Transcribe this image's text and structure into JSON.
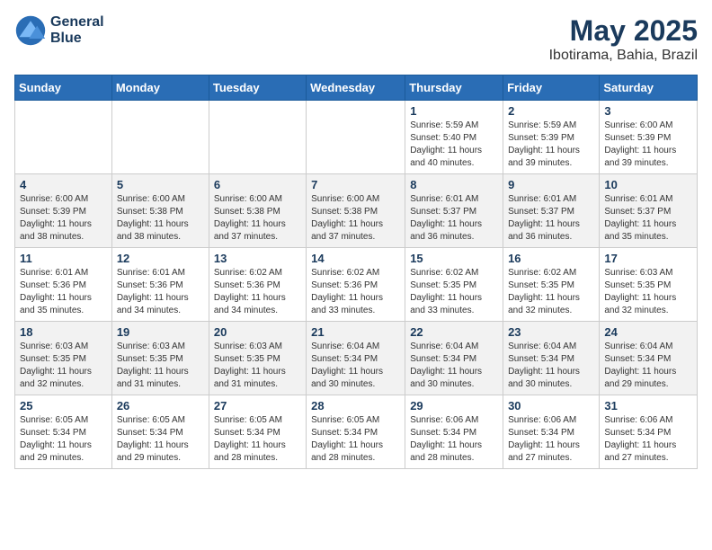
{
  "header": {
    "logo_line1": "General",
    "logo_line2": "Blue",
    "title": "May 2025",
    "subtitle": "Ibotirama, Bahia, Brazil"
  },
  "days_of_week": [
    "Sunday",
    "Monday",
    "Tuesday",
    "Wednesday",
    "Thursday",
    "Friday",
    "Saturday"
  ],
  "weeks": [
    [
      {
        "day": "",
        "info": ""
      },
      {
        "day": "",
        "info": ""
      },
      {
        "day": "",
        "info": ""
      },
      {
        "day": "",
        "info": ""
      },
      {
        "day": "1",
        "info": "Sunrise: 5:59 AM\nSunset: 5:40 PM\nDaylight: 11 hours and 40 minutes."
      },
      {
        "day": "2",
        "info": "Sunrise: 5:59 AM\nSunset: 5:39 PM\nDaylight: 11 hours and 39 minutes."
      },
      {
        "day": "3",
        "info": "Sunrise: 6:00 AM\nSunset: 5:39 PM\nDaylight: 11 hours and 39 minutes."
      }
    ],
    [
      {
        "day": "4",
        "info": "Sunrise: 6:00 AM\nSunset: 5:39 PM\nDaylight: 11 hours and 38 minutes."
      },
      {
        "day": "5",
        "info": "Sunrise: 6:00 AM\nSunset: 5:38 PM\nDaylight: 11 hours and 38 minutes."
      },
      {
        "day": "6",
        "info": "Sunrise: 6:00 AM\nSunset: 5:38 PM\nDaylight: 11 hours and 37 minutes."
      },
      {
        "day": "7",
        "info": "Sunrise: 6:00 AM\nSunset: 5:38 PM\nDaylight: 11 hours and 37 minutes."
      },
      {
        "day": "8",
        "info": "Sunrise: 6:01 AM\nSunset: 5:37 PM\nDaylight: 11 hours and 36 minutes."
      },
      {
        "day": "9",
        "info": "Sunrise: 6:01 AM\nSunset: 5:37 PM\nDaylight: 11 hours and 36 minutes."
      },
      {
        "day": "10",
        "info": "Sunrise: 6:01 AM\nSunset: 5:37 PM\nDaylight: 11 hours and 35 minutes."
      }
    ],
    [
      {
        "day": "11",
        "info": "Sunrise: 6:01 AM\nSunset: 5:36 PM\nDaylight: 11 hours and 35 minutes."
      },
      {
        "day": "12",
        "info": "Sunrise: 6:01 AM\nSunset: 5:36 PM\nDaylight: 11 hours and 34 minutes."
      },
      {
        "day": "13",
        "info": "Sunrise: 6:02 AM\nSunset: 5:36 PM\nDaylight: 11 hours and 34 minutes."
      },
      {
        "day": "14",
        "info": "Sunrise: 6:02 AM\nSunset: 5:36 PM\nDaylight: 11 hours and 33 minutes."
      },
      {
        "day": "15",
        "info": "Sunrise: 6:02 AM\nSunset: 5:35 PM\nDaylight: 11 hours and 33 minutes."
      },
      {
        "day": "16",
        "info": "Sunrise: 6:02 AM\nSunset: 5:35 PM\nDaylight: 11 hours and 32 minutes."
      },
      {
        "day": "17",
        "info": "Sunrise: 6:03 AM\nSunset: 5:35 PM\nDaylight: 11 hours and 32 minutes."
      }
    ],
    [
      {
        "day": "18",
        "info": "Sunrise: 6:03 AM\nSunset: 5:35 PM\nDaylight: 11 hours and 32 minutes."
      },
      {
        "day": "19",
        "info": "Sunrise: 6:03 AM\nSunset: 5:35 PM\nDaylight: 11 hours and 31 minutes."
      },
      {
        "day": "20",
        "info": "Sunrise: 6:03 AM\nSunset: 5:35 PM\nDaylight: 11 hours and 31 minutes."
      },
      {
        "day": "21",
        "info": "Sunrise: 6:04 AM\nSunset: 5:34 PM\nDaylight: 11 hours and 30 minutes."
      },
      {
        "day": "22",
        "info": "Sunrise: 6:04 AM\nSunset: 5:34 PM\nDaylight: 11 hours and 30 minutes."
      },
      {
        "day": "23",
        "info": "Sunrise: 6:04 AM\nSunset: 5:34 PM\nDaylight: 11 hours and 30 minutes."
      },
      {
        "day": "24",
        "info": "Sunrise: 6:04 AM\nSunset: 5:34 PM\nDaylight: 11 hours and 29 minutes."
      }
    ],
    [
      {
        "day": "25",
        "info": "Sunrise: 6:05 AM\nSunset: 5:34 PM\nDaylight: 11 hours and 29 minutes."
      },
      {
        "day": "26",
        "info": "Sunrise: 6:05 AM\nSunset: 5:34 PM\nDaylight: 11 hours and 29 minutes."
      },
      {
        "day": "27",
        "info": "Sunrise: 6:05 AM\nSunset: 5:34 PM\nDaylight: 11 hours and 28 minutes."
      },
      {
        "day": "28",
        "info": "Sunrise: 6:05 AM\nSunset: 5:34 PM\nDaylight: 11 hours and 28 minutes."
      },
      {
        "day": "29",
        "info": "Sunrise: 6:06 AM\nSunset: 5:34 PM\nDaylight: 11 hours and 28 minutes."
      },
      {
        "day": "30",
        "info": "Sunrise: 6:06 AM\nSunset: 5:34 PM\nDaylight: 11 hours and 27 minutes."
      },
      {
        "day": "31",
        "info": "Sunrise: 6:06 AM\nSunset: 5:34 PM\nDaylight: 11 hours and 27 minutes."
      }
    ]
  ]
}
